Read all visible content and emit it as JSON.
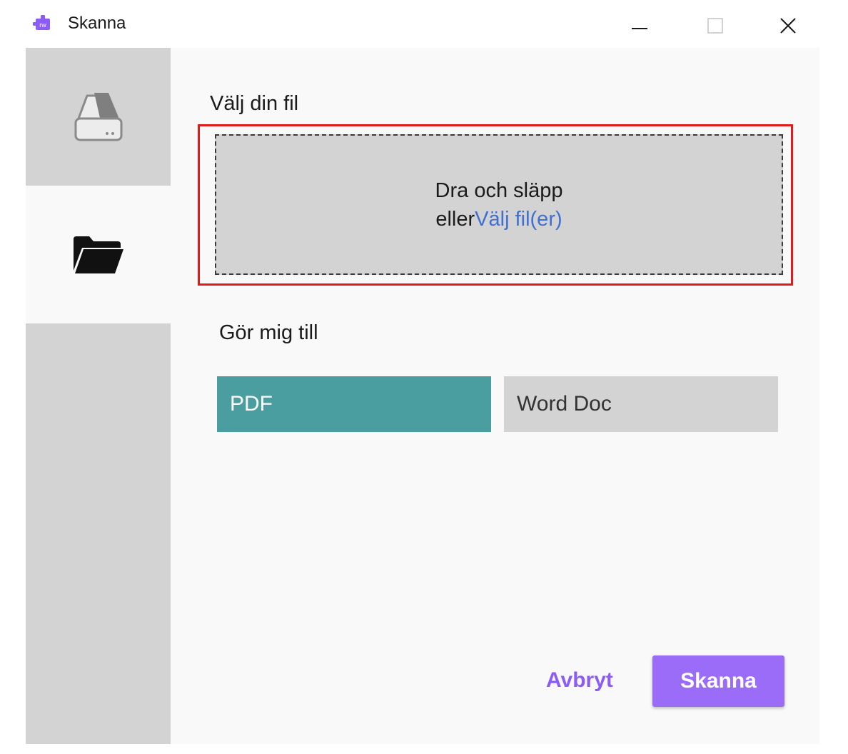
{
  "titlebar": {
    "title": "Skanna",
    "app_icon_text": "rw",
    "icons": [
      "app-icon",
      "minimize-icon",
      "maximize-icon",
      "close-icon"
    ]
  },
  "sidebar": {
    "items": [
      {
        "name": "scanner",
        "icon": "scanner-icon",
        "selected": false
      },
      {
        "name": "files",
        "icon": "folder-icon",
        "selected": true
      }
    ]
  },
  "main": {
    "choose_file_label": "Välj din fil",
    "dropzone": {
      "line1": "Dra och släpp",
      "line2_prefix": "eller",
      "link": "Välj fil(er)"
    },
    "convert_label": "Gör mig till",
    "formats": [
      {
        "label": "PDF",
        "selected": true
      },
      {
        "label": "Word Doc",
        "selected": false
      }
    ],
    "cancel_label": "Avbryt",
    "scan_label": "Skanna"
  },
  "colors": {
    "accent_purple": "#9b6cf7",
    "selected_format": "#4b9e9f",
    "link_blue": "#3f6fd1",
    "highlight_red": "#e01b1b",
    "panel_gray": "#d3d3d3"
  }
}
